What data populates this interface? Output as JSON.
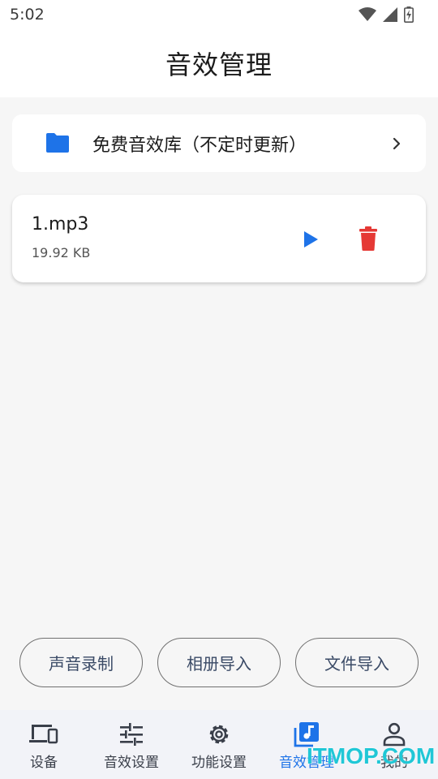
{
  "status_bar": {
    "time": "5:02"
  },
  "app_bar": {
    "title": "音效管理"
  },
  "library": {
    "label": "免费音效库（不定时更新）",
    "icon": "folder-icon"
  },
  "files": [
    {
      "name": "1.mp3",
      "size": "19.92 KB"
    }
  ],
  "import_buttons": {
    "record": "声音录制",
    "album": "相册导入",
    "file": "文件导入"
  },
  "nav": {
    "items": [
      {
        "label": "设备",
        "icon": "devices-icon",
        "active": false
      },
      {
        "label": "音效设置",
        "icon": "sliders-icon",
        "active": false
      },
      {
        "label": "功能设置",
        "icon": "gear-icon",
        "active": false
      },
      {
        "label": "音效管理",
        "icon": "music-library-icon",
        "active": true
      },
      {
        "label": "我的",
        "icon": "person-icon",
        "active": false
      }
    ]
  },
  "watermark": "ITMOP.COM",
  "colors": {
    "accent": "#1e73e8",
    "delete": "#e53935",
    "folder": "#1e73e8"
  }
}
